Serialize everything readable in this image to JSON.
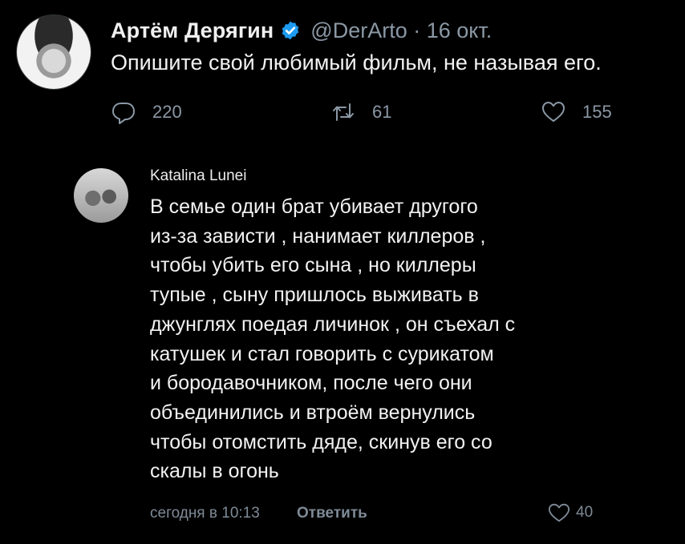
{
  "tweet": {
    "author_name": "Артём Дерягин",
    "handle_time": "@DerArto · 16 окт.",
    "text": "Опишите свой любимый фильм, не называя его.",
    "reply_count": "220",
    "retweet_count": "61",
    "like_count": "155"
  },
  "comment": {
    "author": "Katalina Lunei",
    "lines": [
      "В семье один брат убивает другого",
      "из-за зависти , нанимает киллеров ,",
      "чтобы убить его сына , но киллеры",
      "тупые , сыну пришлось выживать в",
      "джунглях поедая личинок , он съехал с",
      "катушек и стал говорить с сурикатом",
      "и бородавочником, после чего они",
      "объединились и втроём вернулись",
      "чтобы отомстить дяде, скинув его со",
      "скалы в огонь"
    ],
    "timestamp": "сегодня в 10:13",
    "reply_label": "Ответить",
    "like_count": "40"
  },
  "colors": {
    "background": "#000000",
    "text": "#e7e9ea",
    "muted": "#8b98a5",
    "verified": "#1d9bf0"
  },
  "icons": {
    "reply": "reply-icon",
    "retweet": "retweet-icon",
    "like": "heart-icon",
    "verified": "verified-badge-icon"
  }
}
